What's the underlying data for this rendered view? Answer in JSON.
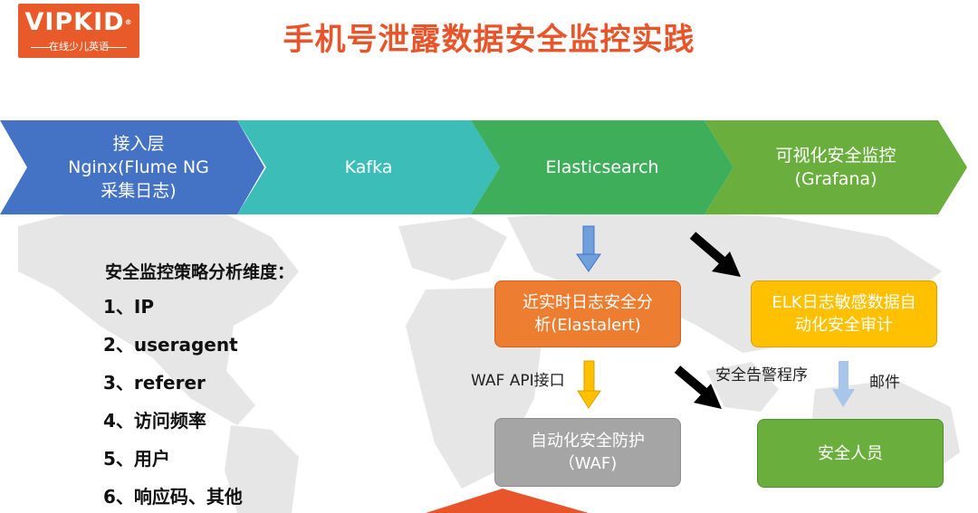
{
  "logo": {
    "brand": "VIPKID",
    "reg_mark": "®",
    "tagline": "在线少儿英语"
  },
  "title": "手机号泄露数据安全监控实践",
  "pipeline": [
    {
      "lines": [
        "接入层",
        "Nginx(Flume NG",
        "采集日志)"
      ],
      "color": "#4472c4"
    },
    {
      "lines": [
        "Kafka"
      ],
      "color": "#3cbdb8"
    },
    {
      "lines": [
        "Elasticsearch"
      ],
      "color": "#3fae5a"
    },
    {
      "lines": [
        "可视化安全监控",
        "(Grafana)"
      ],
      "color": "#6aae3d"
    }
  ],
  "strategy": {
    "heading": "安全监控策略分析维度：",
    "items": [
      "1、IP",
      "2、useragent",
      "3、referer",
      "4、访问频率",
      "5、用户",
      "6、响应码、其他"
    ]
  },
  "boxes": {
    "elastalert": {
      "lines": [
        "近实时日志安全分",
        "析(Elastalert)"
      ],
      "color": "#ed7d31"
    },
    "audit": {
      "lines": [
        "ELK日志敏感数据自",
        "动化安全审计"
      ],
      "color": "#ffc000"
    },
    "waf": {
      "lines": [
        "自动化安全防护",
        "（WAF)"
      ],
      "color": "#a5a5a5"
    },
    "staff": {
      "lines": [
        "安全人员"
      ],
      "color": "#6aae3d"
    }
  },
  "labels": {
    "waf_api": "WAF API接口",
    "alert_program": "安全告警程序",
    "mail": "邮件"
  }
}
